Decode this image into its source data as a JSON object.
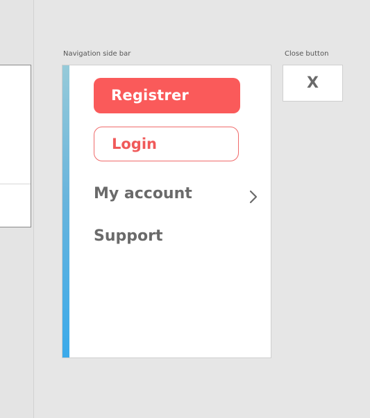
{
  "captions": {
    "nav_sidebar": "Navigation side bar",
    "close_button": "Close button"
  },
  "sidebar": {
    "register_label": "Registrer",
    "login_label": "Login",
    "items": [
      {
        "label": "My account",
        "has_chevron": true
      },
      {
        "label": "Support",
        "has_chevron": false
      }
    ],
    "accent_colors": [
      "#96cad9",
      "#3baaea"
    ]
  },
  "close": {
    "label": "X"
  },
  "colors": {
    "primary": "#fa5a5a",
    "text_muted": "#6a6a6a",
    "background": "#e6e6e6"
  },
  "icons": {
    "my_account_chevron": "chevron-right-icon"
  }
}
